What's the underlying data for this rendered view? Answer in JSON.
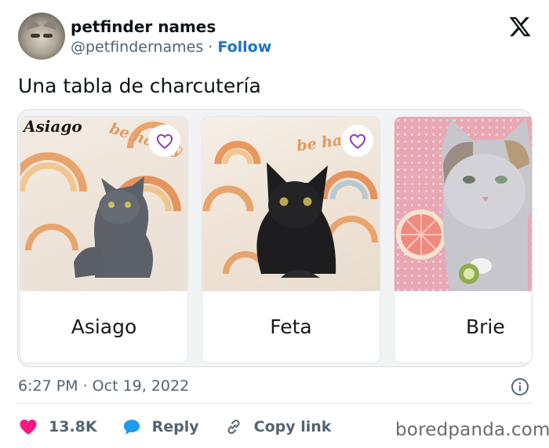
{
  "user": {
    "name": "petfinder names",
    "handle": "@petfindernames",
    "separator": "·",
    "follow_label": "Follow"
  },
  "tweet": {
    "text": "Una tabla de charcutería",
    "timestamp": "6:27 PM · Oct 19, 2022"
  },
  "cards": [
    {
      "name": "Asiago",
      "photo_overlay": "Asiago",
      "photo_stamp": "be happy",
      "favorited": false
    },
    {
      "name": "Feta",
      "photo_stamp": "be happy",
      "favorited": false
    },
    {
      "name": "Brie",
      "favorited": false
    }
  ],
  "actions": {
    "like_count": "13.8K",
    "reply_label": "Reply",
    "copy_link_label": "Copy link"
  },
  "watermark": "boredpanda.com",
  "colors": {
    "like": "#f91880",
    "reply": "#1d9bf0",
    "follow": "#1d73c9",
    "heart_outline": "#8a3fb8",
    "secondary_text": "#536471"
  }
}
